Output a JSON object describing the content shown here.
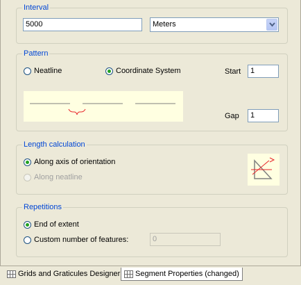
{
  "interval": {
    "title": "Interval",
    "value": "5000",
    "units_selected": "Meters"
  },
  "pattern": {
    "title": "Pattern",
    "option_neatline": "Neatline",
    "option_coordinate_system": "Coordinate System",
    "selected": "Coordinate System",
    "start_label": "Start",
    "start_value": "1",
    "gap_label": "Gap",
    "gap_value": "1"
  },
  "length_calculation": {
    "title": "Length calculation",
    "option_axis": "Along axis of orientation",
    "option_neatline": "Along neatline",
    "selected": "Along axis of orientation"
  },
  "repetitions": {
    "title": "Repetitions",
    "option_end": "End of extent",
    "option_custom": "Custom number of features:",
    "selected": "End of extent",
    "custom_value": "0"
  },
  "tabs": [
    {
      "label": "Grids and Graticules Designer",
      "icon": "grid-icon",
      "active": false
    },
    {
      "label": "Segment Properties (changed)",
      "icon": "grid-icon",
      "active": true
    }
  ],
  "colors": {
    "group_title": "#0046d5",
    "radio_selected": "#21a121",
    "preview_background": "#ffffe1",
    "preview_accent": "#e8262a"
  }
}
